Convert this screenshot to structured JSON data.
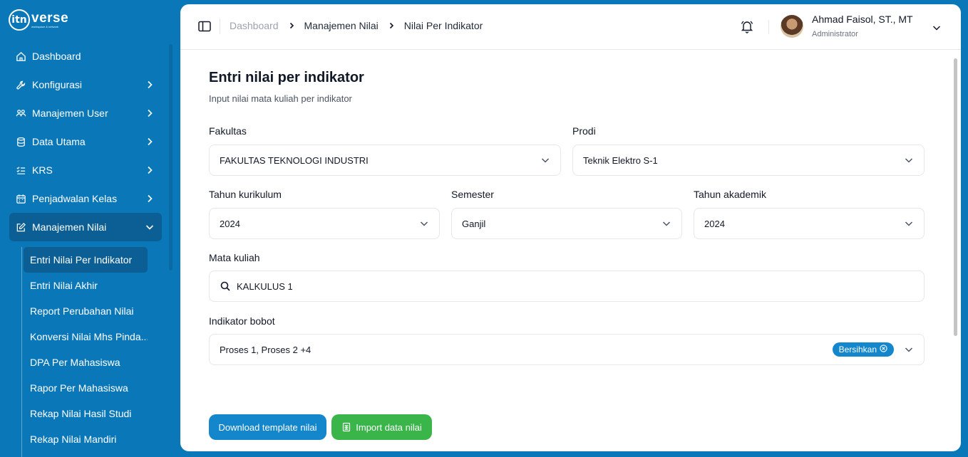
{
  "app": {
    "logo_mark": "itn",
    "logo_text": "verse",
    "logo_sub": "workspace & network"
  },
  "sidebar": {
    "items": [
      {
        "label": "Dashboard",
        "icon": "home-icon",
        "has_children": false
      },
      {
        "label": "Konfigurasi",
        "icon": "wrench-icon",
        "has_children": true
      },
      {
        "label": "Manajemen User",
        "icon": "users-icon",
        "has_children": true
      },
      {
        "label": "Data Utama",
        "icon": "database-icon",
        "has_children": true
      },
      {
        "label": "KRS",
        "icon": "list-check-icon",
        "has_children": true
      },
      {
        "label": "Penjadwalan Kelas",
        "icon": "calendar-icon",
        "has_children": true
      },
      {
        "label": "Manajemen Nilai",
        "icon": "edit-icon",
        "has_children": true,
        "expanded": true
      }
    ],
    "sub_items": [
      "Entri Nilai Per Indikator",
      "Entri Nilai Akhir",
      "Report Perubahan Nilai",
      "Konversi Nilai Mhs Pinda...",
      "DPA Per Mahasiswa",
      "Rapor Per Mahasiswa",
      "Rekap Nilai Hasil Studi",
      "Rekap Nilai Mandiri"
    ]
  },
  "breadcrumb": [
    "Dashboard",
    "Manajemen Nilai",
    "Nilai Per Indikator"
  ],
  "user": {
    "name": "Ahmad Faisol, ST., MT",
    "role": "Administrator"
  },
  "page": {
    "title": "Entri nilai per indikator",
    "subtitle": "Input nilai mata kuliah per indikator"
  },
  "form": {
    "fakultas": {
      "label": "Fakultas",
      "value": "FAKULTAS TEKNOLOGI INDUSTRI"
    },
    "prodi": {
      "label": "Prodi",
      "value": "Teknik Elektro S-1"
    },
    "tahun_kurikulum": {
      "label": "Tahun kurikulum",
      "value": "2024"
    },
    "semester": {
      "label": "Semester",
      "value": "Ganjil"
    },
    "tahun_akademik": {
      "label": "Tahun akademik",
      "value": "2024"
    },
    "mata_kuliah": {
      "label": "Mata kuliah",
      "value": "KALKULUS 1"
    },
    "indikator_bobot": {
      "label": "Indikator bobot",
      "value": "Proses 1, Proses 2 +4",
      "clear_label": "Bersihkan"
    }
  },
  "actions": {
    "download_label": "Download template nilai",
    "import_label": "Import data nilai"
  },
  "colors": {
    "brand": "#0a78b8",
    "accent": "#1486cc",
    "success": "#3ab54a"
  }
}
